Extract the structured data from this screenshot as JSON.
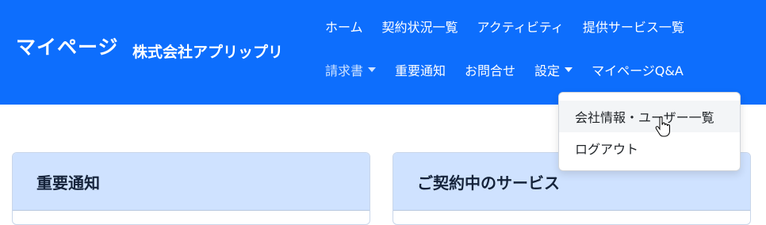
{
  "header": {
    "brand": "マイページ",
    "company": "株式会社アプリップリ",
    "nav_row1": [
      "ホーム",
      "契約状況一覧",
      "アクティビティ",
      "提供サービス一覧"
    ],
    "nav_row2": {
      "invoice": "請求書",
      "important": "重要通知",
      "contact": "お問合せ",
      "settings": "設定",
      "qa": "マイページQ&A"
    }
  },
  "settings_menu": {
    "items": [
      "会社情報・ユーザー一覧",
      "ログアウト"
    ]
  },
  "cards": {
    "important": "重要通知",
    "services": "ご契約中のサービス"
  },
  "colors": {
    "navbar": "#0d6efd",
    "card_header": "#cfe2ff"
  },
  "icons": [
    "caret-down-icon",
    "hand-pointer-icon"
  ]
}
